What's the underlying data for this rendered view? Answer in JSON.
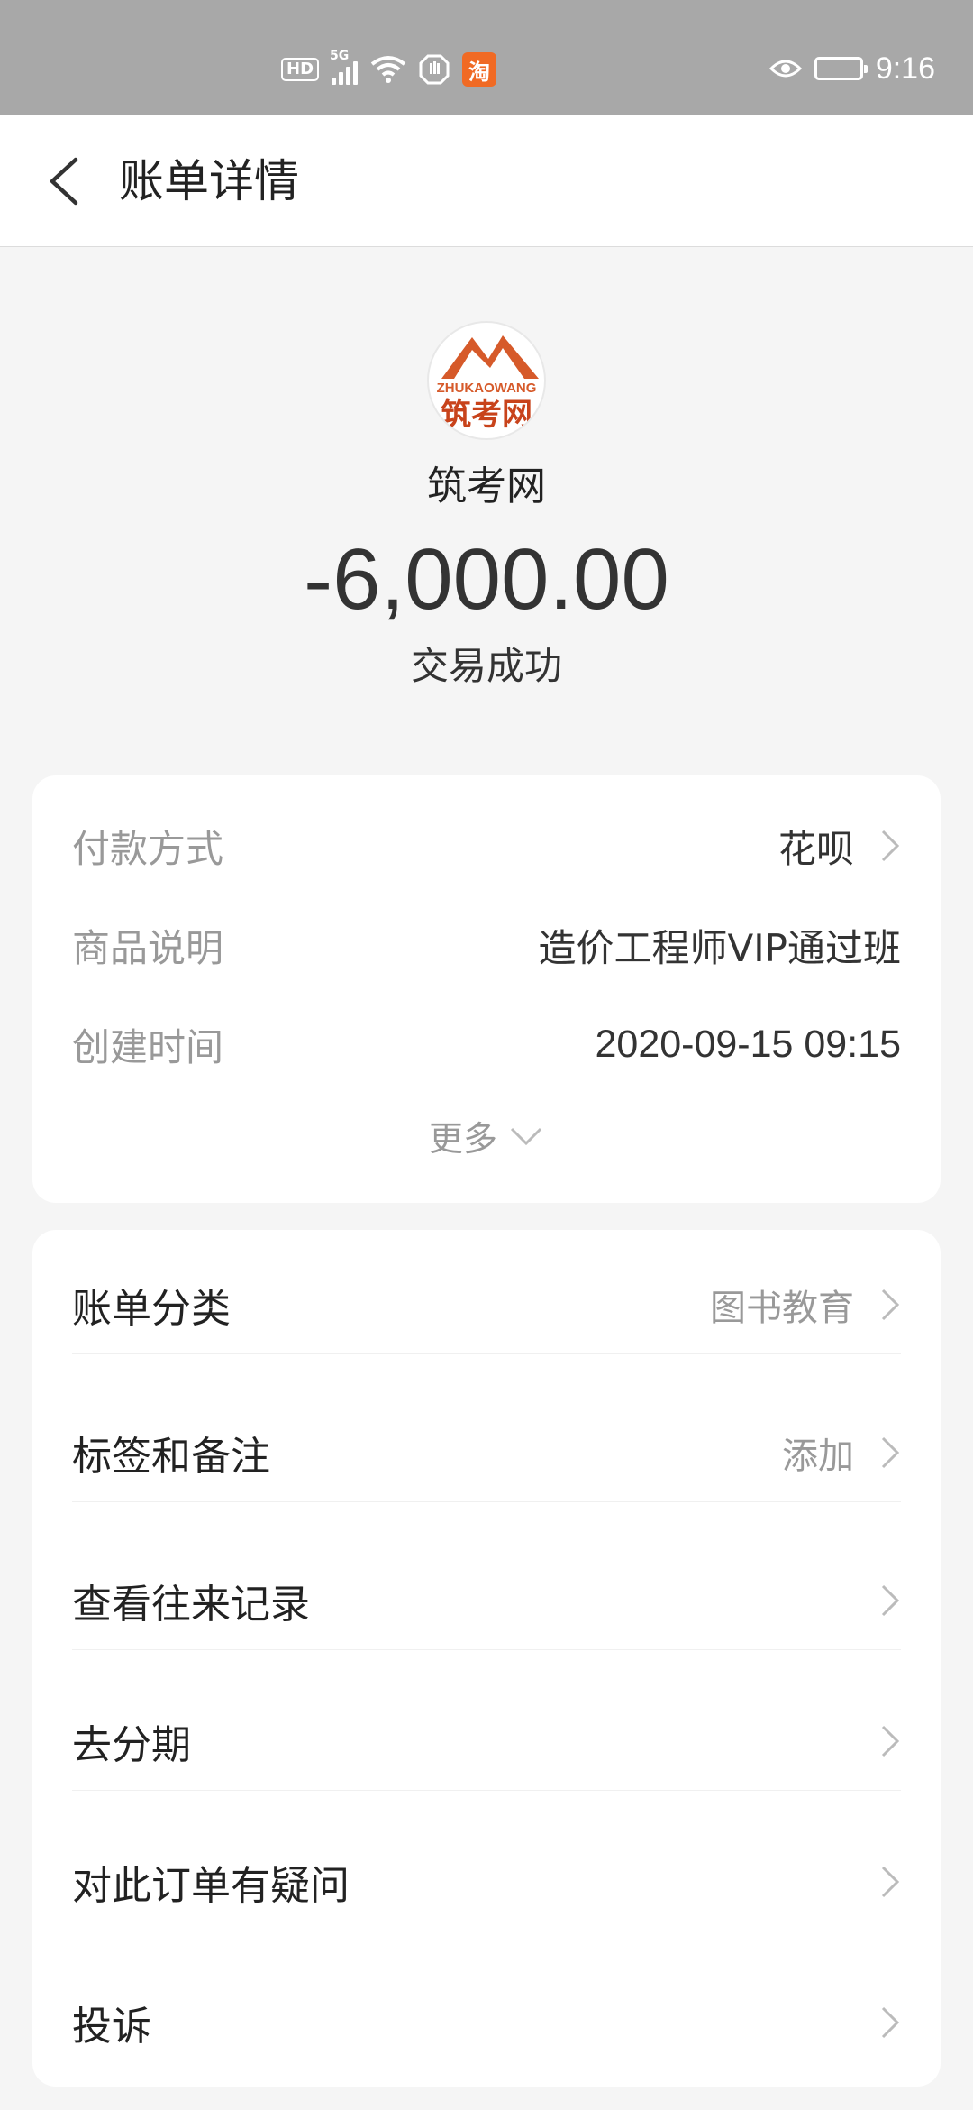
{
  "status_bar": {
    "hd_badge": "HD",
    "network": "5G",
    "taobao_icon": "淘",
    "time": "9:16"
  },
  "header": {
    "title": "账单详情"
  },
  "merchant": {
    "logo_word": "ZHUKAOWANG",
    "logo_cn": "筑考网",
    "name": "筑考网",
    "amount": "-6,000.00",
    "status": "交易成功"
  },
  "details": {
    "rows": [
      {
        "label": "付款方式",
        "value": "花呗"
      },
      {
        "label": "商品说明",
        "value": "造价工程师VIP通过班"
      },
      {
        "label": "创建时间",
        "value": "2020-09-15 09:15"
      }
    ],
    "more_label": "更多"
  },
  "menu": {
    "items": [
      {
        "label": "账单分类",
        "value": "图书教育"
      },
      {
        "label": "标签和备注",
        "value": "添加"
      },
      {
        "label": "查看往来记录",
        "value": ""
      },
      {
        "label": "去分期",
        "value": ""
      },
      {
        "label": "对此订单有疑问",
        "value": ""
      },
      {
        "label": "投诉",
        "value": ""
      }
    ]
  },
  "colors": {
    "status_bar_bg": "#a8a8a8",
    "page_bg": "#f5f5f5",
    "logo_orange": "#d65a2a",
    "muted_text": "#999999"
  }
}
